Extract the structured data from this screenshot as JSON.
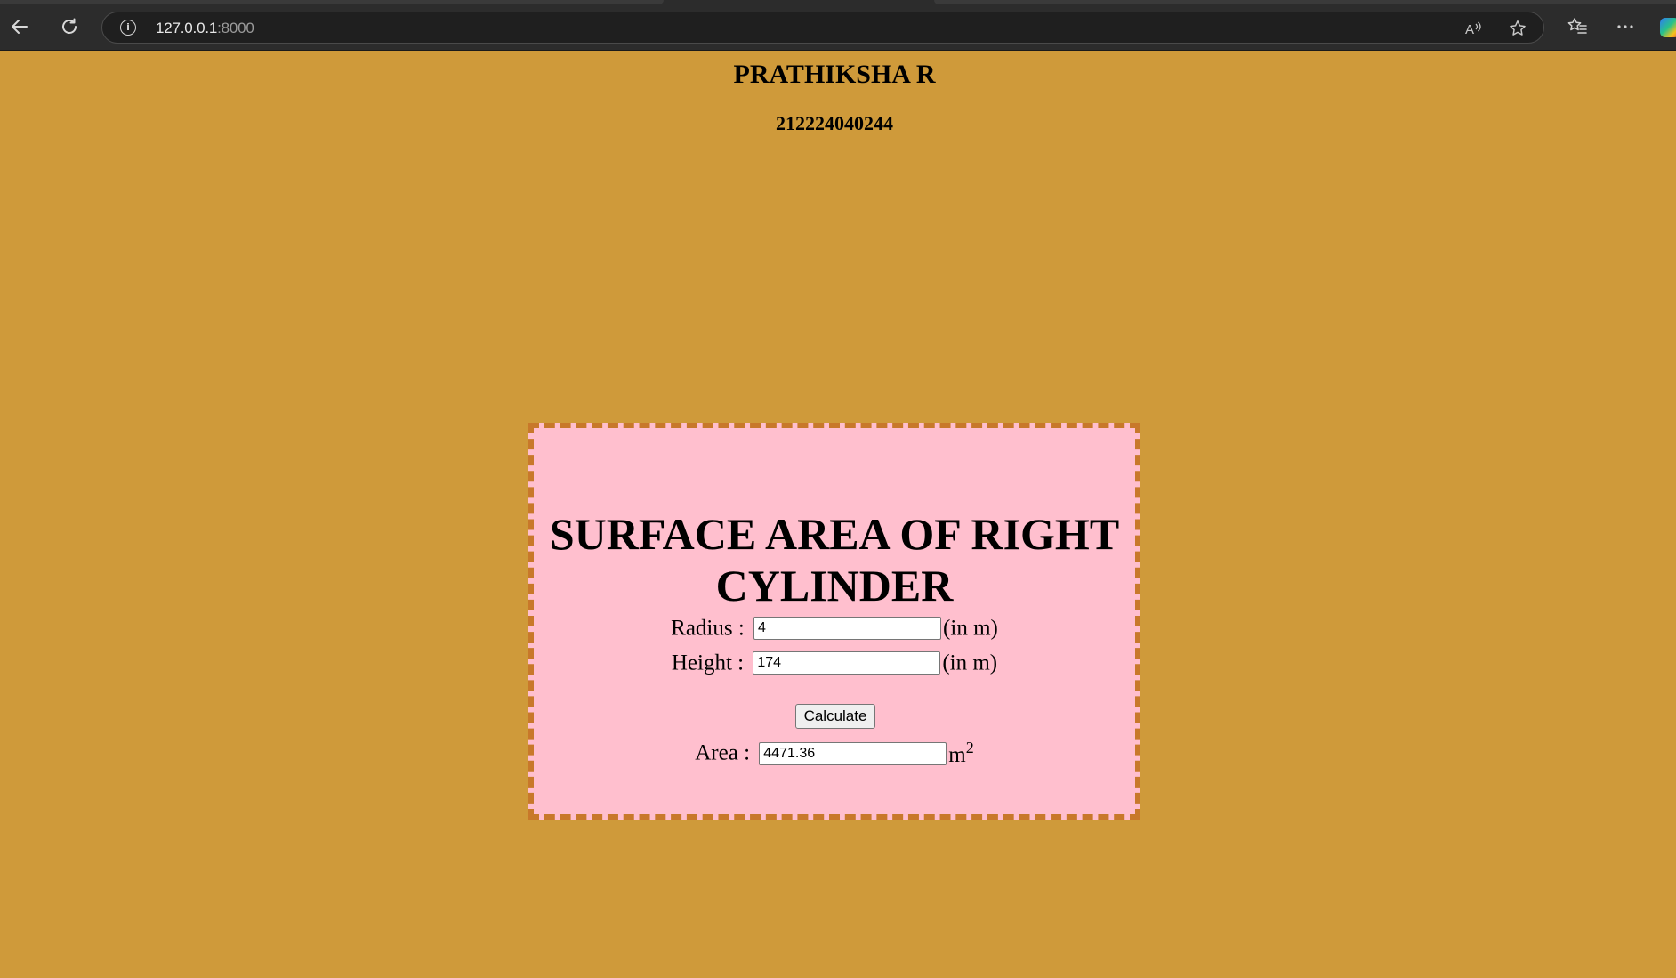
{
  "browser": {
    "url_host": "127.0.0.1",
    "url_port": ":8000",
    "icons": [
      "back-arrow-icon",
      "refresh-icon",
      "site-info-icon",
      "read-aloud-icon",
      "favorite-star-icon",
      "favorites-icon",
      "more-menu-icon",
      "copilot-icon"
    ]
  },
  "page": {
    "name": "PRATHIKSHA R",
    "register_number": "212224040244",
    "background_color": "#cf9a3a"
  },
  "calculator": {
    "title": "SURFACE AREA OF RIGHT CYLINDER",
    "box_color": "#ffbfce",
    "border_color": "#c8782a",
    "radius": {
      "label": "Radius :",
      "value": "4",
      "unit": "(in m)"
    },
    "height": {
      "label": "Height :",
      "value": "174",
      "unit": "(in m)"
    },
    "calculate_label": "Calculate",
    "area": {
      "label": "Area :",
      "value": "4471.36",
      "unit": "m",
      "unit_exponent": "2"
    }
  }
}
